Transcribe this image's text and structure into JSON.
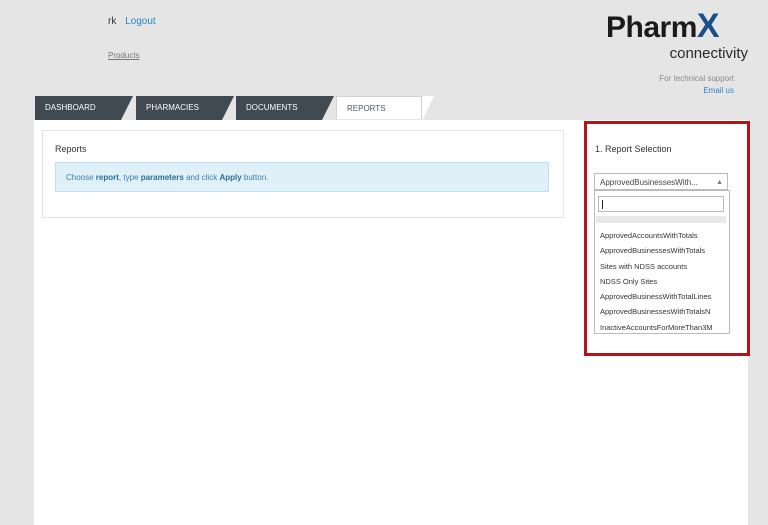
{
  "header": {
    "user_name": "rk",
    "logout_label": "Logout",
    "products_label": "Products",
    "logo_main": "Pharm",
    "logo_x": "X",
    "logo_sub": "connectivity",
    "support_text": "For technical support",
    "email_label": "Email us"
  },
  "tabs": [
    {
      "label": "DASHBOARD",
      "active": false
    },
    {
      "label": "PHARMACIES",
      "active": false
    },
    {
      "label": "DOCUMENTS",
      "active": false
    },
    {
      "label": "REPORTS",
      "active": true
    }
  ],
  "reports": {
    "title": "Reports",
    "info_prefix": "Choose ",
    "info_report": "report",
    "info_mid1": ", type ",
    "info_parameters": "parameters",
    "info_mid2": " and click ",
    "info_apply": "Apply",
    "info_suffix": " button."
  },
  "selection": {
    "title": "1. Report Selection",
    "selected_value": "ApprovedBusinessesWith...",
    "search_value": "",
    "options": [
      "ApprovedAccountsWithTotals",
      "ApprovedBusinessesWithTotals",
      "Sites with NDSS accounts",
      "NDSS Only Sites",
      "ApprovedBusinessWithTotalLines",
      "ApprovedBusinessesWithTotalsN",
      "InactiveAccountsForMoreThan3M"
    ]
  },
  "colors": {
    "tab_dark": "#3f4a52",
    "link_blue": "#2a86c8",
    "highlight_red": "#b3141c",
    "info_bg": "#dff0f8",
    "logo_blue": "#1a4f8c"
  },
  "icons": {
    "select_arrow": "caret-down-icon"
  }
}
